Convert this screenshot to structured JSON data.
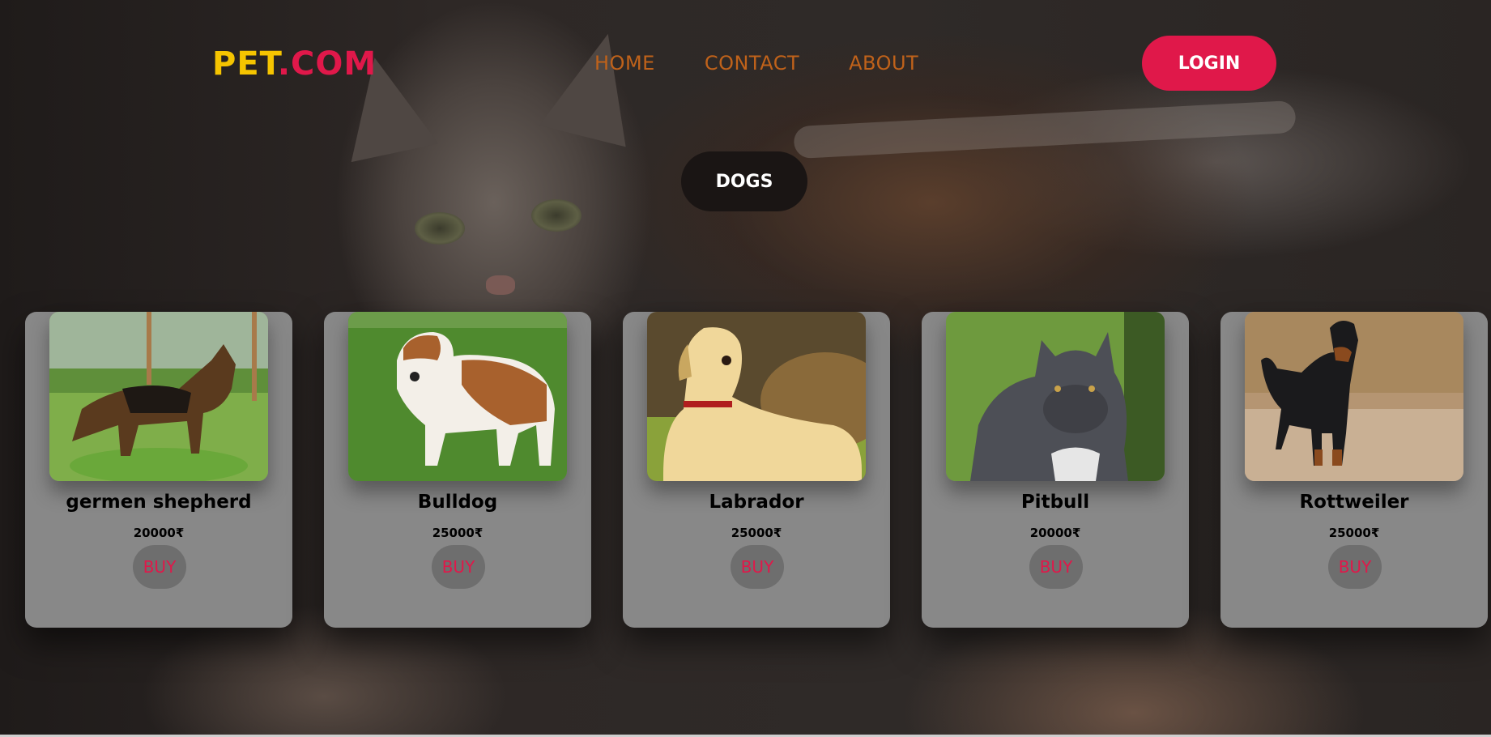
{
  "header": {
    "logo_part1": "PET",
    "logo_part2": ".COM",
    "nav": [
      "HOME",
      "CONTACT",
      "ABOUT"
    ],
    "login_label": "LOGIN"
  },
  "category_label": "DOGS",
  "cards": [
    {
      "name": "germen shepherd",
      "price": "20000₹",
      "buy": "BUY",
      "photo": "german-shepherd-photo"
    },
    {
      "name": "Bulldog",
      "price": "25000₹",
      "buy": "BUY",
      "photo": "bulldog-photo"
    },
    {
      "name": "Labrador",
      "price": "25000₹",
      "buy": "BUY",
      "photo": "labrador-photo"
    },
    {
      "name": "Pitbull",
      "price": "20000₹",
      "buy": "BUY",
      "photo": "pitbull-photo"
    },
    {
      "name": "Rottweiler",
      "price": "25000₹",
      "buy": "BUY",
      "photo": "rottweiler-photo"
    }
  ],
  "colors": {
    "logo_yellow": "#f5c400",
    "accent_red": "#e0184a",
    "nav_orange": "#c0621a",
    "card_gray": "#888888"
  }
}
